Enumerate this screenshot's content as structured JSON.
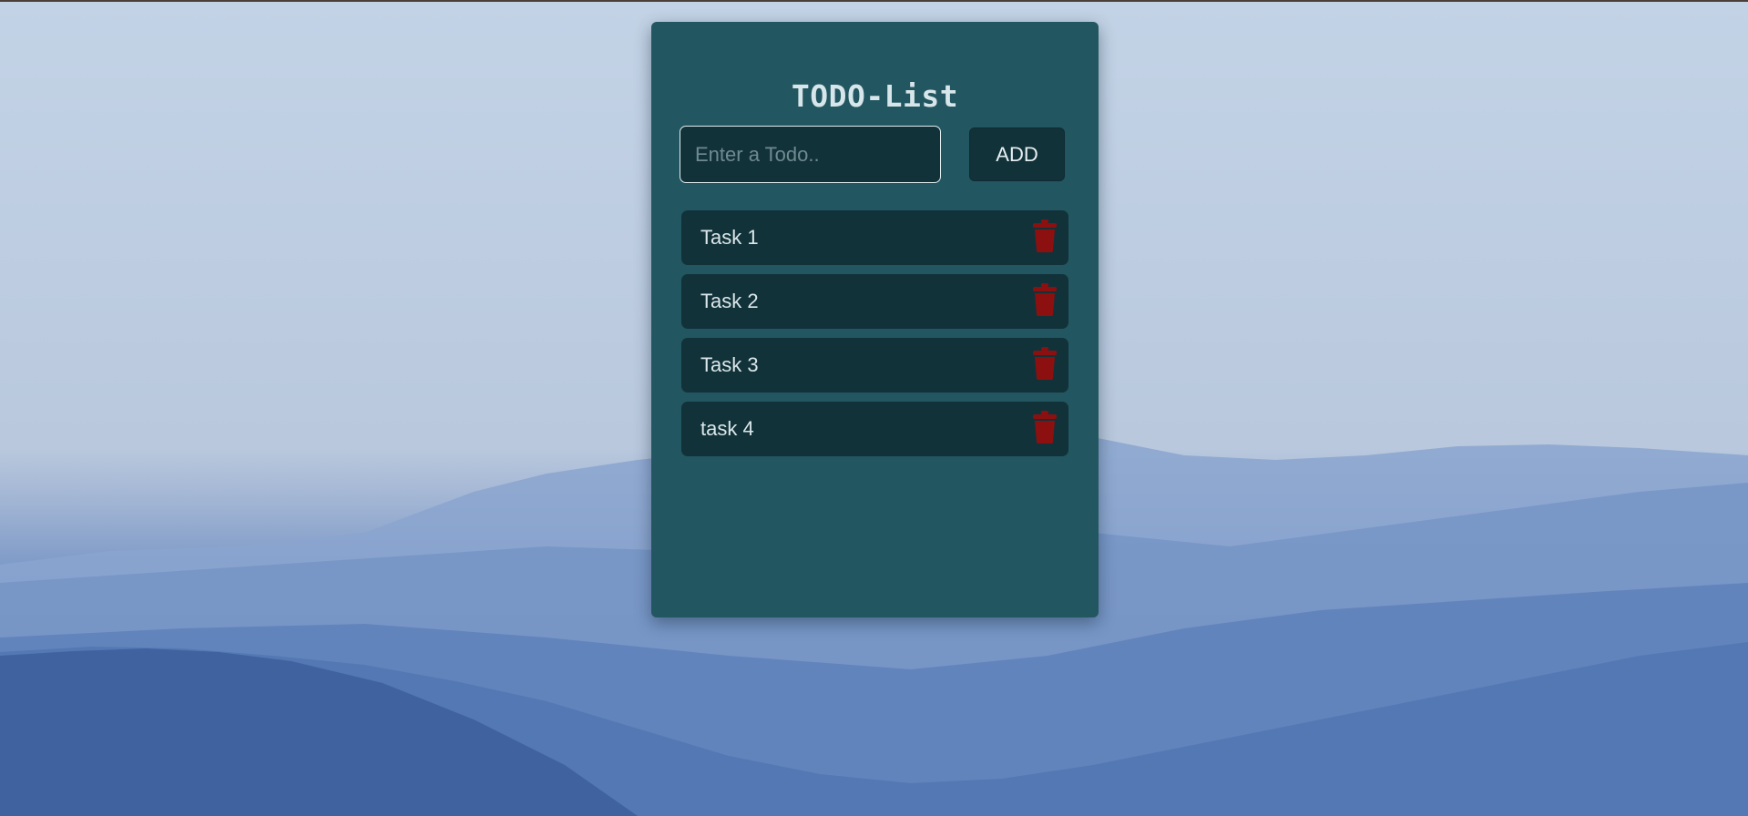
{
  "app": {
    "title": "TODO-List"
  },
  "form": {
    "input_value": "",
    "input_placeholder": "Enter a Todo..",
    "add_label": "ADD"
  },
  "todos": [
    {
      "text": "Task 1",
      "delete_icon": "trash-icon"
    },
    {
      "text": "Task 2",
      "delete_icon": "trash-icon"
    },
    {
      "text": "Task 3",
      "delete_icon": "trash-icon"
    },
    {
      "text": "task 4",
      "delete_icon": "trash-icon"
    }
  ],
  "colors": {
    "card": "#225660",
    "field": "#12323a",
    "delete": "#8c1010"
  }
}
